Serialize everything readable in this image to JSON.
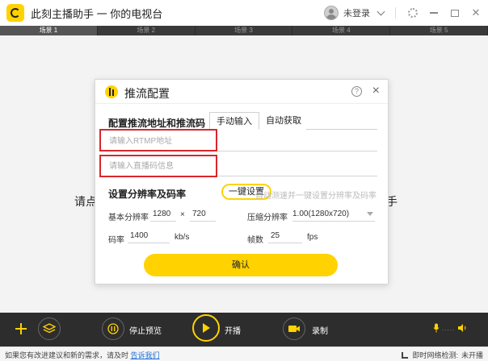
{
  "app": {
    "title": "此刻主播助手 一 你的电视台",
    "login_label": "未登录"
  },
  "scenes": [
    "场景 1",
    "场景 2",
    "场景 3",
    "场景 4",
    "场景 5"
  ],
  "canvas": {
    "hint_left": "请点",
    "hint_right": "手"
  },
  "dialog": {
    "title": "推流配置",
    "help_glyph": "?",
    "close_glyph": "×",
    "section_address": "配置推流地址和推流码",
    "tabs": [
      "手动输入",
      "自动获取"
    ],
    "rtmp_placeholder": "请输入RTMP地址",
    "key_placeholder": "请输入直播码信息",
    "section_resolution": "设置分辨率及码率",
    "one_click_label": "一键设置",
    "auto_hint": "自动测速并一键设置分辨率及码率",
    "base_resolution_label": "基本分辨率",
    "base_width": "1280",
    "times": "×",
    "base_height": "720",
    "compressed_resolution_label": "压缩分辨率",
    "compressed_resolution_value": "1.00(1280x720)",
    "bitrate_label": "码率",
    "bitrate_value": "1400",
    "bitrate_unit": "kb/s",
    "fps_label": "帧数",
    "fps_value": "25",
    "fps_unit": "fps",
    "confirm_label": "确认"
  },
  "toolbar": {
    "stop_preview_label": "停止预览",
    "start_label": "开播",
    "record_label": "录制"
  },
  "status": {
    "left_text": "如果您有改进建议和新的需求，请及时",
    "feedback_link": "告诉我们",
    "net_label": "即时网络检测:",
    "net_value": "未开播"
  },
  "colors": {
    "accent": "#ffd200",
    "highlight_box": "#d9262c",
    "toolbar_bg": "#2d2d2d"
  }
}
